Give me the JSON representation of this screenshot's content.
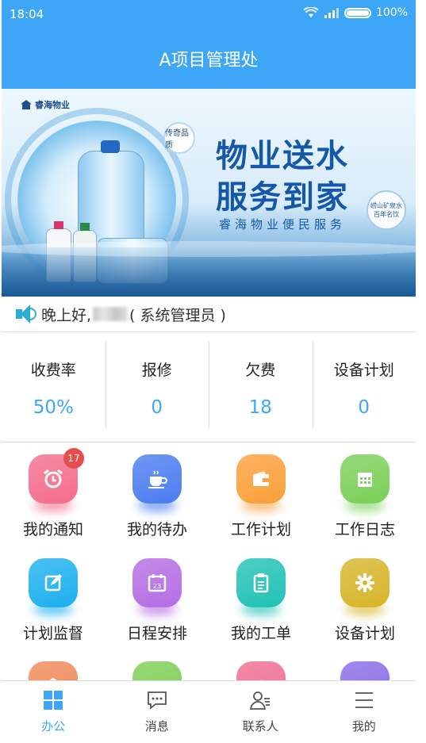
{
  "status_bar": {
    "time": "18:04",
    "battery": "100%"
  },
  "header": {
    "title": "A项目管理处"
  },
  "banner": {
    "logo_text": "睿海物业",
    "badge_top": "传奇品质",
    "slogan_line1": "物业送水",
    "slogan_line2": "服务到家",
    "slogan_sub": "睿海物业便民服务",
    "badge_right": "崂山矿泉水百年名饮"
  },
  "greeting": {
    "prefix": "晚上好,",
    "suffix": "( 系统管理员 )"
  },
  "stats": [
    {
      "label": "收费率",
      "value": "50%"
    },
    {
      "label": "报修",
      "value": "0"
    },
    {
      "label": "欠费",
      "value": "18"
    },
    {
      "label": "设备计划",
      "value": "0"
    }
  ],
  "grid": [
    {
      "label": "我的通知",
      "icon": "alarm-clock-icon",
      "color": "#f46e8c",
      "badge": "17"
    },
    {
      "label": "我的待办",
      "icon": "coffee-cup-icon",
      "color": "#4c7ef0"
    },
    {
      "label": "工作计划",
      "icon": "wallet-icon",
      "color": "#fba03a"
    },
    {
      "label": "工作日志",
      "icon": "calendar-grid-icon",
      "color": "#7bd05a"
    },
    {
      "label": "计划监督",
      "icon": "edit-icon",
      "color": "#1eb0ef"
    },
    {
      "label": "日程安排",
      "icon": "calendar-23-icon",
      "color": "#b56ee3"
    },
    {
      "label": "我的工单",
      "icon": "clipboard-icon",
      "color": "#22c2b6"
    },
    {
      "label": "设备计划",
      "icon": "gear-icon",
      "color": "#d7b52a"
    },
    {
      "label": "",
      "icon": "home-icon",
      "color": "#f08a5a"
    },
    {
      "label": "",
      "icon": "flower-icon",
      "color": "#7fcf55"
    },
    {
      "label": "",
      "icon": "target-icon",
      "color": "#ef6f93"
    },
    {
      "label": "",
      "icon": "document-icon",
      "color": "#8a6ee6"
    }
  ],
  "tabs": [
    {
      "label": "办公",
      "icon": "grid-icon",
      "active": true
    },
    {
      "label": "消息",
      "icon": "chat-bubble-icon",
      "active": false
    },
    {
      "label": "联系人",
      "icon": "contacts-icon",
      "active": false
    },
    {
      "label": "我的",
      "icon": "menu-icon",
      "active": false
    }
  ],
  "accent_color": "#3da6f7"
}
